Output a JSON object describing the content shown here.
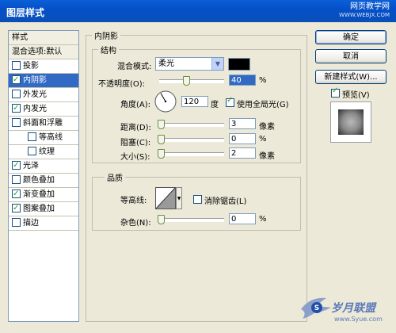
{
  "window": {
    "title": "图层样式"
  },
  "watermark_top": {
    "line1": "网页教学网",
    "line2": "WWW.WEBJX.COM"
  },
  "watermark_bottom": {
    "text": "岁月联盟",
    "url": "www.Syue.com"
  },
  "sidebar": {
    "items": [
      {
        "label": "样式",
        "checkbox": false,
        "checked": false,
        "indent": false,
        "selected": false,
        "header": true
      },
      {
        "label": "混合选项:默认",
        "checkbox": false,
        "checked": false,
        "indent": false,
        "selected": false,
        "header": true
      },
      {
        "label": "投影",
        "checkbox": true,
        "checked": false,
        "indent": false,
        "selected": false
      },
      {
        "label": "内阴影",
        "checkbox": true,
        "checked": true,
        "indent": false,
        "selected": true
      },
      {
        "label": "外发光",
        "checkbox": true,
        "checked": false,
        "indent": false,
        "selected": false
      },
      {
        "label": "内发光",
        "checkbox": true,
        "checked": true,
        "indent": false,
        "selected": false
      },
      {
        "label": "斜面和浮雕",
        "checkbox": true,
        "checked": false,
        "indent": false,
        "selected": false
      },
      {
        "label": "等高线",
        "checkbox": true,
        "checked": false,
        "indent": true,
        "selected": false
      },
      {
        "label": "纹理",
        "checkbox": true,
        "checked": false,
        "indent": true,
        "selected": false
      },
      {
        "label": "光泽",
        "checkbox": true,
        "checked": true,
        "indent": false,
        "selected": false
      },
      {
        "label": "颜色叠加",
        "checkbox": true,
        "checked": false,
        "indent": false,
        "selected": false
      },
      {
        "label": "渐变叠加",
        "checkbox": true,
        "checked": true,
        "indent": false,
        "selected": false
      },
      {
        "label": "图案叠加",
        "checkbox": true,
        "checked": true,
        "indent": false,
        "selected": false
      },
      {
        "label": "描边",
        "checkbox": true,
        "checked": false,
        "indent": false,
        "selected": false
      }
    ]
  },
  "panel": {
    "title": "内阴影",
    "structure": {
      "title": "结构",
      "blend_mode_label": "混合模式:",
      "blend_mode_value": "柔光",
      "blend_color": "#000000",
      "opacity_label": "不透明度(O):",
      "opacity_value": "40",
      "opacity_unit": "%",
      "opacity_level": 0.4,
      "angle_label": "角度(A):",
      "angle_value": "120",
      "angle_unit": "度",
      "global_light_label": "使用全局光(G)",
      "global_light_checked": true,
      "distance_label": "距离(D):",
      "distance_value": "3",
      "distance_unit": "像素",
      "choke_label": "阻塞(C):",
      "choke_value": "0",
      "choke_unit": "%",
      "size_label": "大小(S):",
      "size_value": "2",
      "size_unit": "像素"
    },
    "quality": {
      "title": "品质",
      "contour_label": "等高线:",
      "antialias_label": "消除锯齿(L)",
      "antialias_checked": false,
      "noise_label": "杂色(N):",
      "noise_value": "0",
      "noise_unit": "%"
    }
  },
  "buttons": {
    "ok": "确定",
    "cancel": "取消",
    "new_style": "新建样式(W)...",
    "preview_label": "预览(V)",
    "preview_checked": true
  }
}
